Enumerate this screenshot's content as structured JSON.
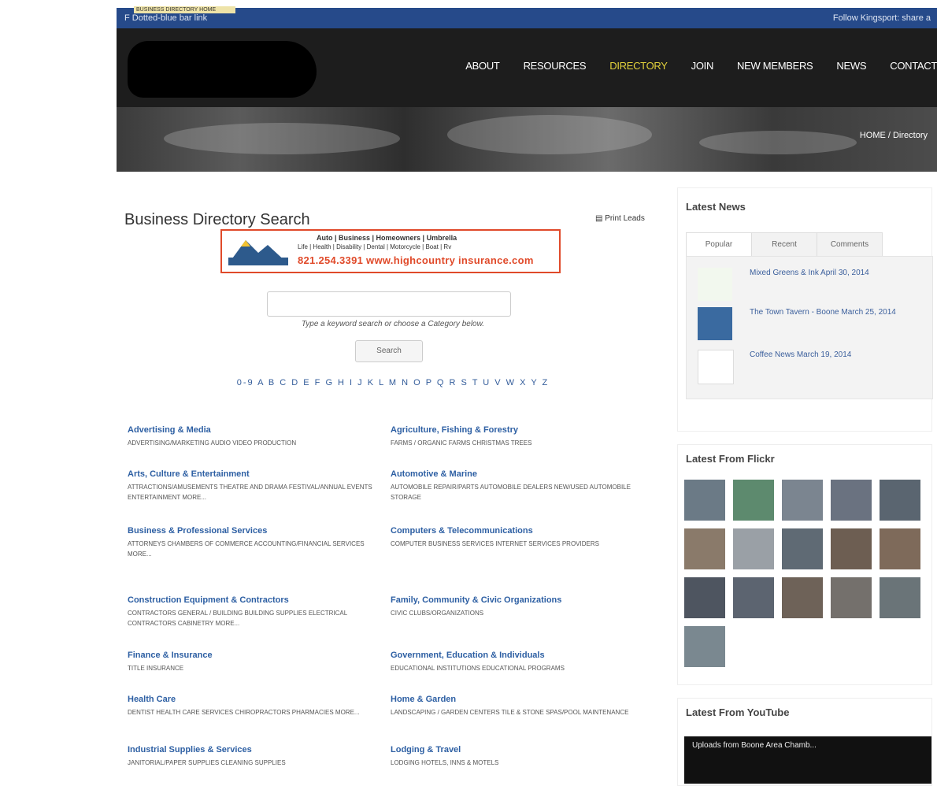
{
  "topbar": {
    "left": "F Dotted-blue bar link",
    "right": "Follow Kingsport: share a",
    "badge": "BUSINESS DIRECTORY HOME"
  },
  "nav": {
    "items": [
      "ABOUT",
      "RESOURCES",
      "DIRECTORY",
      "JOIN",
      "NEW MEMBERS",
      "NEWS",
      "CONTACT"
    ],
    "active": "DIRECTORY"
  },
  "breadcrumb": "HOME / Directory",
  "main": {
    "title": "Business Directory Search",
    "print_label": "Print Leads",
    "ad": {
      "line1": "Auto | Business | Homeowners | Umbrella",
      "line2": "Life | Health | Disability | Dental | Motorcycle | Boat | Rv",
      "line3": "821.254.3391  www.highcountry insurance.com"
    },
    "search_hint": "Type a keyword search or choose a Category below.",
    "search_button": "Search",
    "alphabet": "0-9 A B C D E F G H I J K L M N O P Q R S T U V W X Y Z"
  },
  "categories": [
    {
      "name": "Advertising & Media",
      "sub": "ADVERTISING/MARKETING AUDIO VIDEO PRODUCTION"
    },
    {
      "name": "Agriculture, Fishing & Forestry",
      "sub": "FARMS / ORGANIC FARMS CHRISTMAS TREES"
    },
    {
      "name": "Arts, Culture & Entertainment",
      "sub": "ATTRACTIONS/AMUSEMENTS THEATRE AND DRAMA FESTIVAL/ANNUAL EVENTS ENTERTAINMENT More..."
    },
    {
      "name": "Automotive & Marine",
      "sub": "AUTOMOBILE REPAIR/PARTS AUTOMOBILE DEALERS NEW/USED AUTOMOBILE STORAGE"
    },
    {
      "name": "Business & Professional Services",
      "sub": "ATTORNEYS CHAMBERS OF COMMERCE ACCOUNTING/FINANCIAL SERVICES More..."
    },
    {
      "name": "Computers & Telecommunications",
      "sub": "COMPUTER BUSINESS SERVICES INTERNET SERVICES PROVIDERS"
    },
    {
      "name": "Construction Equipment & Contractors",
      "sub": "CONTRACTORS GENERAL / BUILDING BUILDING SUPPLIES ELECTRICAL CONTRACTORS CABINETRY More..."
    },
    {
      "name": "Family, Community & Civic Organizations",
      "sub": "CIVIC CLUBS/ORGANIZATIONS"
    },
    {
      "name": "Finance & Insurance",
      "sub": "TITLE INSURANCE"
    },
    {
      "name": "Government, Education & Individuals",
      "sub": "EDUCATIONAL INSTITUTIONS EDUCATIONAL PROGRAMS"
    },
    {
      "name": "Health Care",
      "sub": "DENTIST HEALTH CARE SERVICES CHIROPRACTORS PHARMACIES More..."
    },
    {
      "name": "Home & Garden",
      "sub": "LANDSCAPING / GARDEN CENTERS TILE & STONE SPAS/POOL MAINTENANCE"
    },
    {
      "name": "Industrial Supplies & Services",
      "sub": "JANITORIAL/PAPER SUPPLIES CLEANING SUPPLIES"
    },
    {
      "name": "Lodging & Travel",
      "sub": "LODGING HOTELS, INNS & MOTELS"
    }
  ],
  "sidebar": {
    "news_title": "Latest News",
    "tabs": [
      "Popular",
      "Recent",
      "Comments"
    ],
    "news": [
      {
        "text": "Mixed Greens & Ink  April 30, 2014"
      },
      {
        "text": "The Town Tavern - Boone  March 25, 2014"
      },
      {
        "text": "Coffee News  March 19, 2014"
      }
    ],
    "flickr_title": "Latest From Flickr",
    "youtube_title": "Latest From YouTube",
    "youtube_video": "Uploads from Boone Area Chamb..."
  },
  "colors": {
    "topbar": "#264a8a",
    "link": "#2d5fa3",
    "accent": "#e3d23c",
    "ad_border": "#e04a2a"
  }
}
